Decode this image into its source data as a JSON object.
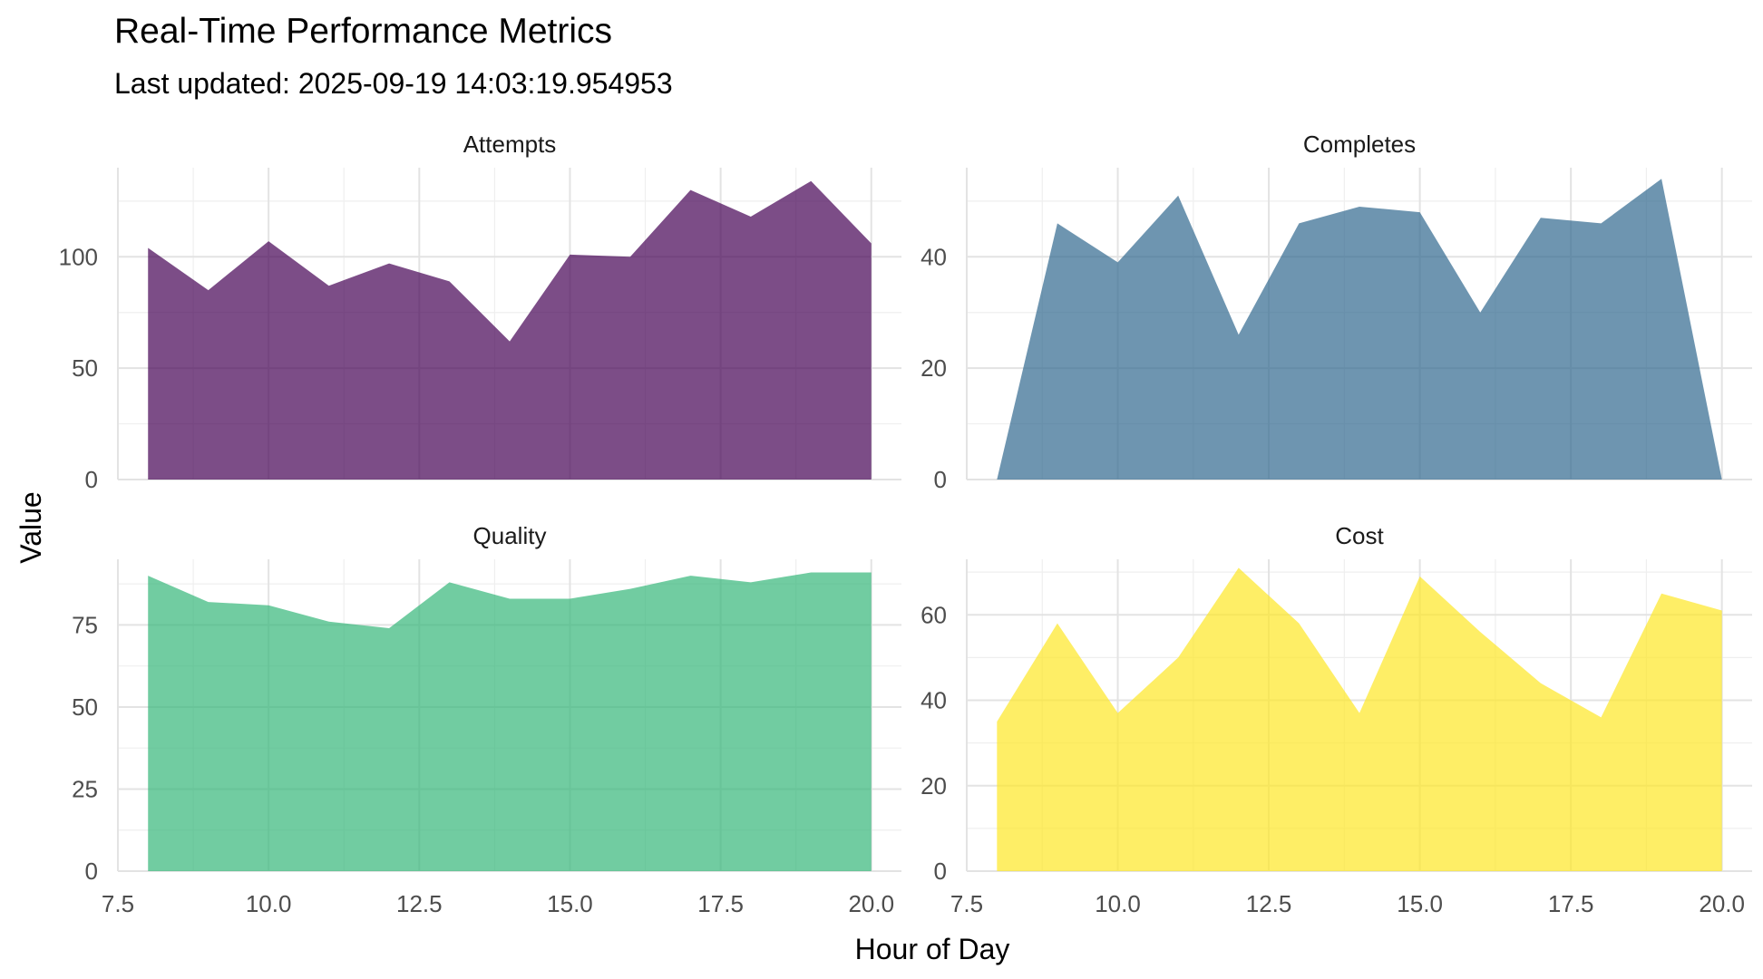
{
  "chart_data": {
    "type": "area",
    "title": "Real-Time Performance Metrics",
    "subtitle": "Last updated: 2025-09-19 14:03:19.954953",
    "xlabel": "Hour of Day",
    "ylabel": "Value",
    "grid": true,
    "x_ticks": [
      7.5,
      10.0,
      12.5,
      15.0,
      17.5,
      20.0
    ],
    "x_tick_labels": [
      "7.5",
      "10.0",
      "12.5",
      "15.0",
      "17.5",
      "20.0"
    ],
    "xlim": [
      7.5,
      20.5
    ],
    "x": [
      8,
      9,
      10,
      11,
      12,
      13,
      14,
      15,
      16,
      17,
      18,
      19,
      20
    ],
    "panels": [
      {
        "name": "Attempts",
        "color": "#440154",
        "values": [
          104,
          85,
          107,
          87,
          97,
          89,
          62,
          101,
          100,
          130,
          118,
          134,
          106
        ],
        "ylim": [
          0,
          140
        ],
        "y_ticks": [
          0,
          50,
          100
        ],
        "y_tick_labels": [
          "0",
          "50",
          "100"
        ]
      },
      {
        "name": "Completes",
        "color": "#31688E",
        "values": [
          0,
          46,
          39,
          51,
          26,
          46,
          49,
          48,
          30,
          47,
          46,
          54,
          0
        ],
        "ylim": [
          0,
          56
        ],
        "y_ticks": [
          0,
          20,
          40
        ],
        "y_tick_labels": [
          "0",
          "20",
          "40"
        ]
      },
      {
        "name": "Quality",
        "color": "#35B779",
        "values": [
          90,
          82,
          81,
          76,
          74,
          88,
          83,
          83,
          86,
          90,
          88,
          91,
          91
        ],
        "ylim": [
          0,
          95
        ],
        "y_ticks": [
          0,
          25,
          50,
          75
        ],
        "y_tick_labels": [
          "0",
          "25",
          "50",
          "75"
        ]
      },
      {
        "name": "Cost",
        "color": "#FDE725",
        "values": [
          35,
          58,
          37,
          50,
          71,
          58,
          37,
          69,
          56,
          44,
          36,
          65,
          61
        ],
        "ylim": [
          0,
          73
        ],
        "y_ticks": [
          0,
          20,
          40,
          60
        ],
        "y_tick_labels": [
          "0",
          "20",
          "40",
          "60"
        ]
      }
    ]
  }
}
